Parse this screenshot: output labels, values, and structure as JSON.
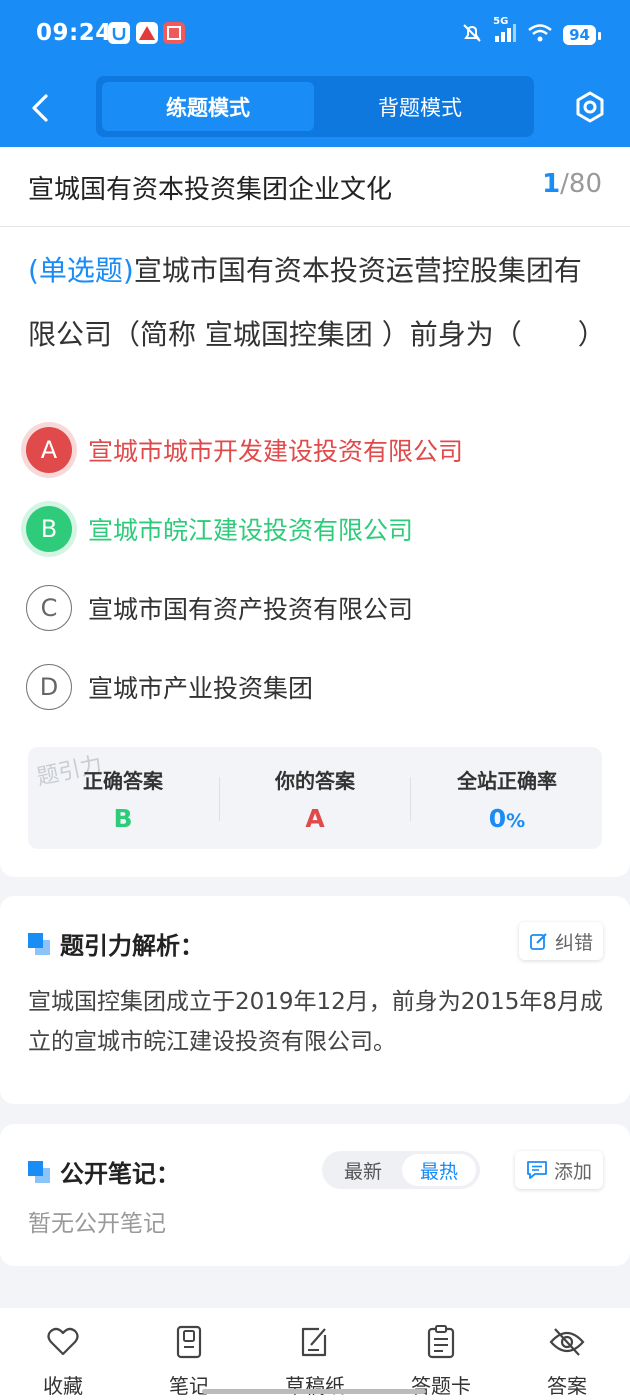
{
  "status_bar": {
    "time": "09:24",
    "battery": "94",
    "network": "5G"
  },
  "header": {
    "modes": [
      "练题模式",
      "背题模式"
    ],
    "active_mode": "练题模式",
    "accent": "#1a8cf5"
  },
  "paper": {
    "title": "宣城国有资本投资集团企业文化",
    "current": "1",
    "total": "/80"
  },
  "question": {
    "type": "(单选题)",
    "text": "宣城市国有资本投资运营控股集团有限公司（简称 宣城国控集团 ）前身为（　　）",
    "options": [
      {
        "letter": "A",
        "text": "宣城市城市开发建设投资有限公司",
        "state": "wrong"
      },
      {
        "letter": "B",
        "text": "宣城市皖江建设投资有限公司",
        "state": "correct"
      },
      {
        "letter": "C",
        "text": "宣城市国有资产投资有限公司",
        "state": "normal"
      },
      {
        "letter": "D",
        "text": "宣城市产业投资集团",
        "state": "normal"
      }
    ]
  },
  "answer_summary": {
    "watermark": "题引力",
    "correct_label": "正确答案",
    "correct_value": "B",
    "yours_label": "你的答案",
    "yours_value": "A",
    "rate_label": "全站正确率",
    "rate_value": "0",
    "rate_unit": "%"
  },
  "analysis": {
    "title": "题引力解析：",
    "report_label": "纠错",
    "text": "宣城国控集团成立于2019年12月，前身为2015年8月成立的宣城市皖江建设投资有限公司。"
  },
  "notes": {
    "title": "公开笔记：",
    "sort_options": [
      "最新",
      "最热"
    ],
    "active_sort": "最热",
    "add_label": "添加",
    "empty_text": "暂无公开笔记"
  },
  "bottom_bar": [
    {
      "label": "收藏",
      "icon": "heart-icon"
    },
    {
      "label": "笔记",
      "icon": "notebook-icon"
    },
    {
      "label": "草稿纸",
      "icon": "draft-icon"
    },
    {
      "label": "答题卡",
      "icon": "answer-card-icon"
    },
    {
      "label": "答案",
      "icon": "eye-off-icon"
    }
  ]
}
